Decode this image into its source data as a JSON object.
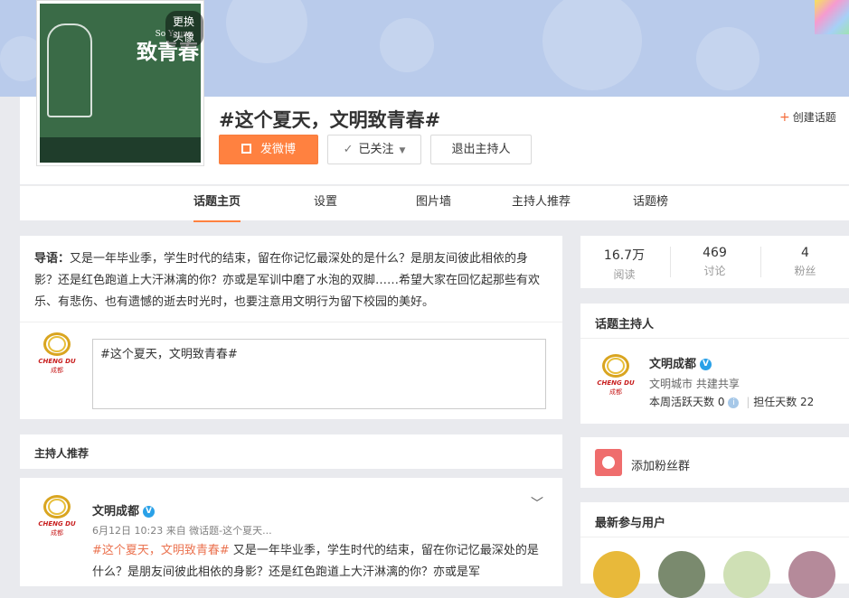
{
  "header": {
    "avatar_change_label": "更换头像",
    "avatar_art_title": "致青春",
    "avatar_art_subtitle": "So Young",
    "topic_title": "#这个夏天，文明致青春#",
    "post_button": "发微博",
    "follow_button": "已关注",
    "quit_host_button": "退出主持人",
    "create_topic": "创建话题"
  },
  "nav": {
    "tabs": [
      {
        "label": "话题主页",
        "active": true
      },
      {
        "label": "设置"
      },
      {
        "label": "图片墙"
      },
      {
        "label": "主持人推荐"
      },
      {
        "label": "话题榜"
      }
    ]
  },
  "intro": {
    "label": "导语：",
    "text": "又是一年毕业季，学生时代的结束，留在你记忆最深处的是什么？是朋友间彼此相依的身影？还是红色跑道上大汗淋漓的你？亦或是军训中磨了水泡的双脚……希望大家在回忆起那些有欢乐、有悲伤、也有遗憾的逝去时光时，也要注意用文明行为留下校园的美好。",
    "compose_value": "#这个夏天，文明致青春#"
  },
  "logo": {
    "en": "CHENG DU",
    "cn": "成都"
  },
  "host_recommend": {
    "section_title": "主持人推荐",
    "post": {
      "author": "文明成都",
      "verified_badge": "V",
      "meta": "6月12日 10:23 来自 微话题-这个夏天...",
      "tag": "#这个夏天，文明致青春#",
      "text": " 又是一年毕业季，学生时代的结束，留在你记忆最深处的是什么？是朋友间彼此相依的身影？还是红色跑道上大汗淋漓的你？亦或是军"
    }
  },
  "stats": [
    {
      "value": "16.7万",
      "label": "阅读"
    },
    {
      "value": "469",
      "label": "讨论"
    },
    {
      "value": "4",
      "label": "粉丝"
    }
  ],
  "topic_host": {
    "section_title": "话题主持人",
    "name": "文明成都",
    "verified_badge": "V",
    "desc": "文明城市 共建共享",
    "active_days_label": "本周活跃天数",
    "active_days": "0",
    "info_icon": "i",
    "served_days_label": "担任天数",
    "served_days": "22"
  },
  "fans_group": {
    "label": "添加粉丝群"
  },
  "latest_users": {
    "section_title": "最新参与用户"
  },
  "colors": {
    "accent": "#ff8140",
    "link": "#eb7350",
    "verified": "#2aa1e8",
    "banner": "#b9cbeb"
  }
}
